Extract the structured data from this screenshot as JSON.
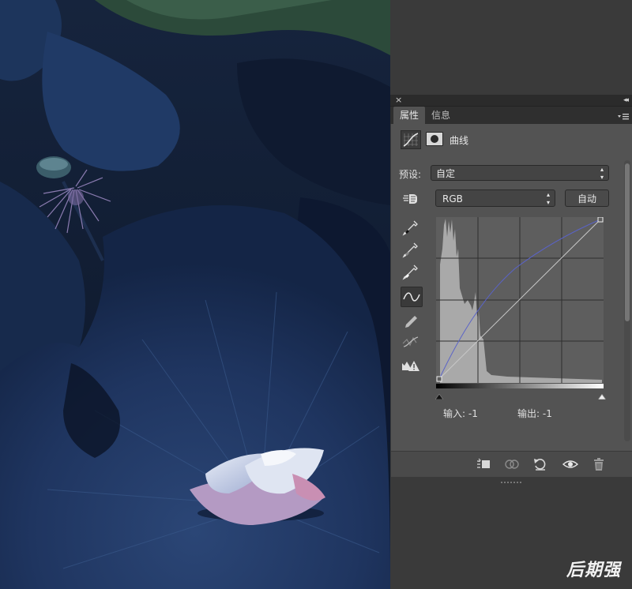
{
  "panel": {
    "tabs": [
      {
        "label": "属性",
        "active": true
      },
      {
        "label": "信息",
        "active": false
      }
    ],
    "close_glyph": "×",
    "collapse_glyph": "◂◂"
  },
  "adjustment": {
    "title": "曲线",
    "icon": "curves-adjustment-icon",
    "mask_icon": "layer-mask-icon"
  },
  "preset": {
    "label": "预设:",
    "value": "自定"
  },
  "channel": {
    "value": "RGB",
    "auto_label": "自动"
  },
  "tools": [
    "on-image-adjust-hand-icon",
    "black-point-eyedropper-icon",
    "gray-point-eyedropper-icon",
    "white-point-eyedropper-icon",
    "curve-edit-icon",
    "pencil-draw-icon",
    "smooth-curve-icon",
    "clipping-warning-icon"
  ],
  "readout": {
    "input": "输入: -1",
    "output": "输出: -1"
  },
  "footer_icons": [
    "clip-to-layer-icon",
    "view-previous-state-icon",
    "reset-adjustment-icon",
    "toggle-visibility-eye-icon",
    "delete-adjustment-icon"
  ],
  "colors": {
    "panel_bg": "#535353",
    "graph_bg": "#5e5e5e",
    "curve_line": "#c8c8c8",
    "blue_curve": "#5a63c8",
    "histogram": "#a9a9a9",
    "photo_dominant": "#1a2d52"
  },
  "watermark": "后期强"
}
